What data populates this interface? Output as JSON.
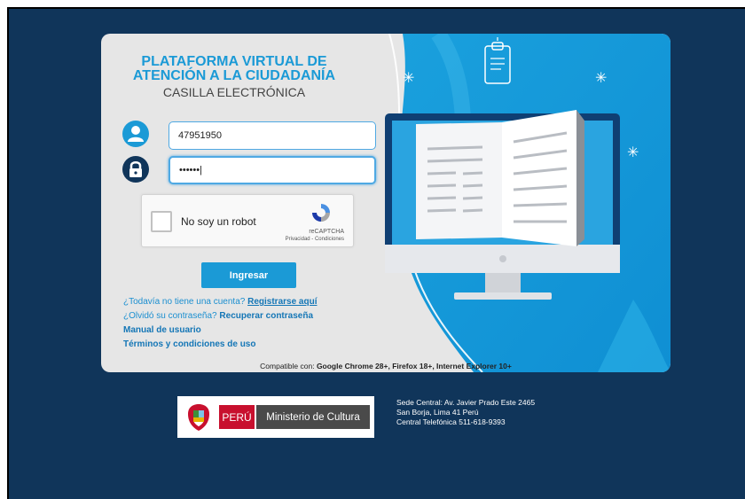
{
  "header": {
    "title_line1": "PLATAFORMA VIRTUAL DE",
    "title_line2": "ATENCIÓN A LA CIUDADANÍA",
    "subtitle": "CASILLA ELECTRÓNICA"
  },
  "form": {
    "username_value": "47951950",
    "password_value": "••••••|",
    "captcha_label": "No soy un robot",
    "captcha_brand": "reCAPTCHA",
    "captcha_terms": "Privacidad - Condiciones",
    "submit_label": "Ingresar"
  },
  "links": {
    "no_account_text": "¿Todavía no tiene una cuenta?",
    "register_label": "Registrarse aquí",
    "forgot_text": "¿Olvidó su contraseña?",
    "recover_label": "Recuperar contraseña",
    "manual_label": "Manual de usuario",
    "terms_label": "Términos y condiciones de uso"
  },
  "compat": {
    "prefix": "Compatible con:",
    "browsers": "Google Chrome 28+, Firefox 18+, Internet Explorer 10+"
  },
  "footer": {
    "peru_label": "PERÚ",
    "ministry_label": "Ministerio de Cultura",
    "address_line1": "Sede Central: Av. Javier Prado Este 2465",
    "address_line2": "San Borja, Lima 41 Perú",
    "address_line3": "Central Telefónica 511-618-9393"
  },
  "colors": {
    "background": "#10355a",
    "accent": "#1b9ad6",
    "peru_red": "#c8102e"
  },
  "icons": [
    "user-icon",
    "lock-icon",
    "recaptcha-logo-icon",
    "clipboard-icon",
    "computer-book-icon",
    "coat-of-arms-icon",
    "sparkle-icon"
  ]
}
